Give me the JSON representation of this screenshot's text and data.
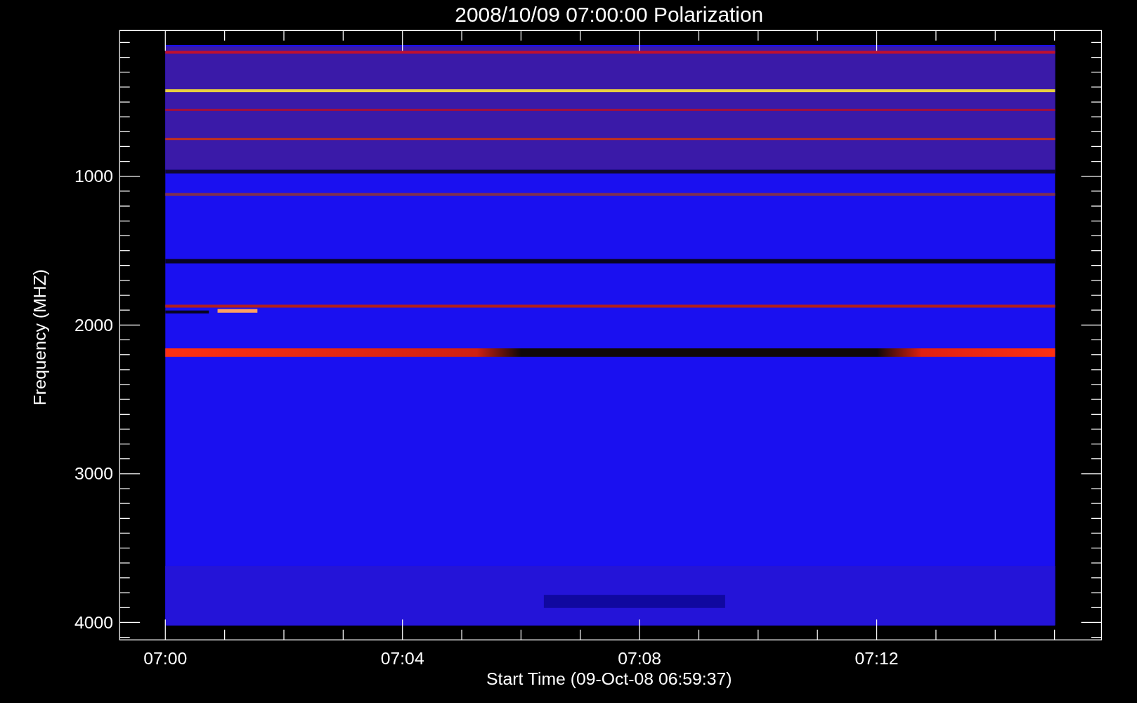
{
  "title": "2008/10/09 07:00:00 Polarization",
  "y_axis": {
    "label": "Frequency (MHZ)",
    "ticks": [
      "1000",
      "2000",
      "3000",
      "4000"
    ]
  },
  "x_axis": {
    "label": "Start Time (09-Oct-08 06:59:37)",
    "ticks": [
      "07:00",
      "07:04",
      "07:08",
      "07:12"
    ]
  }
}
